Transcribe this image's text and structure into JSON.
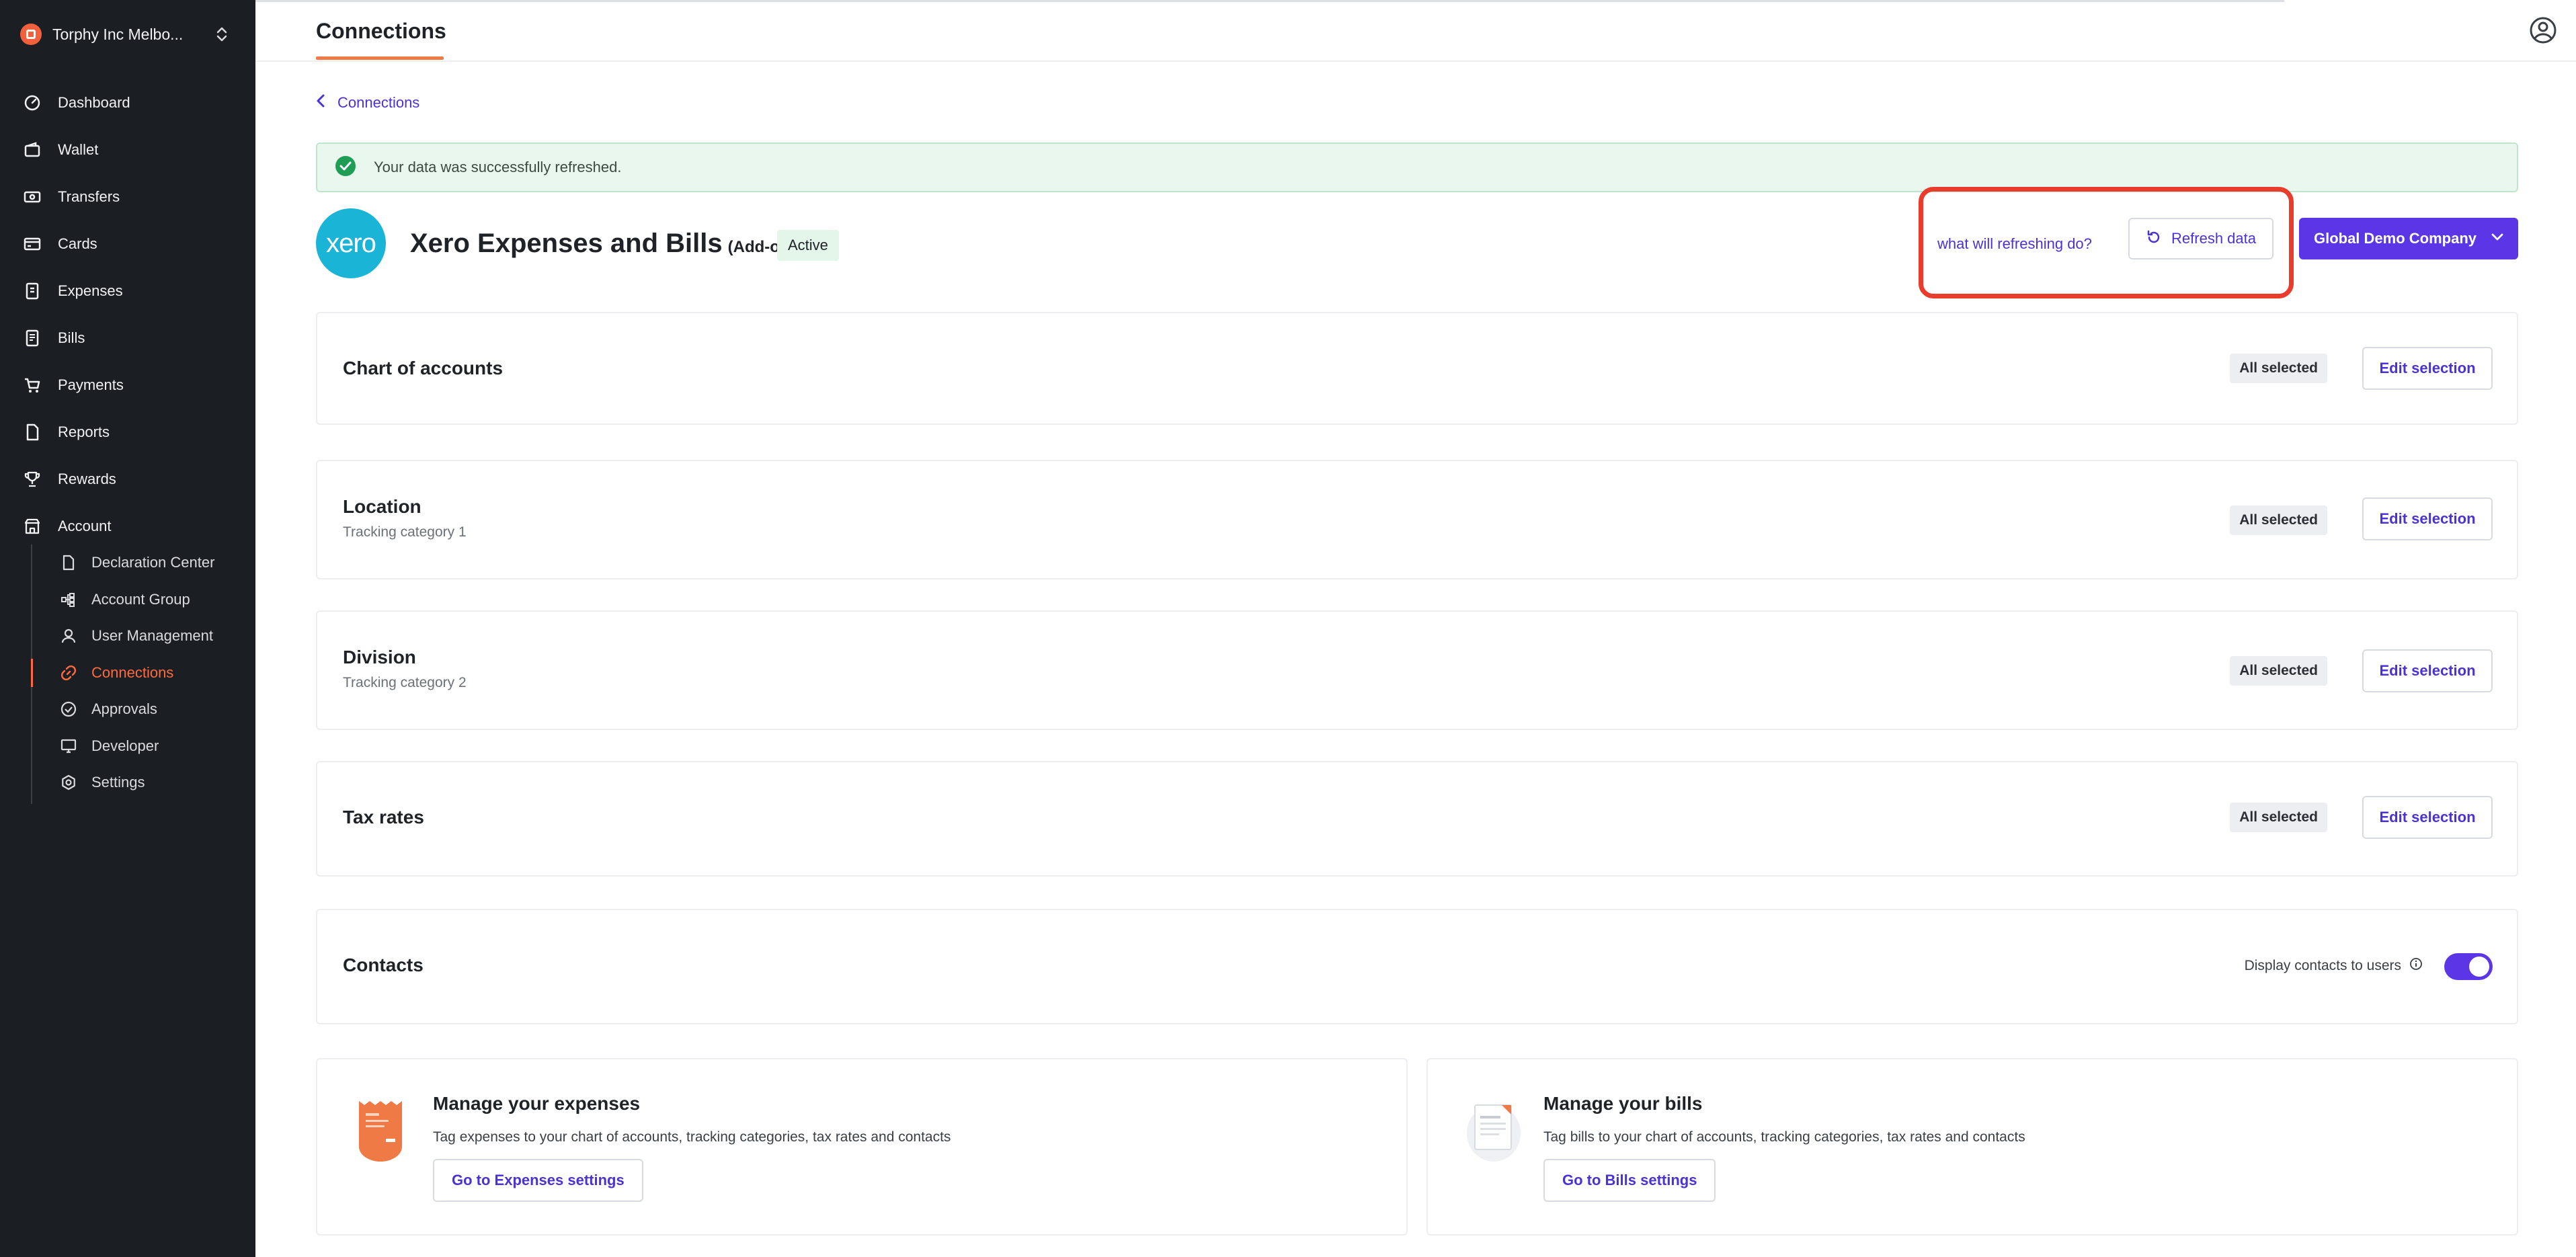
{
  "sidebar": {
    "org_name": "Torphy Inc Melbo...",
    "items": [
      {
        "label": "Dashboard",
        "icon": "dashboard-icon"
      },
      {
        "label": "Wallet",
        "icon": "wallet-icon"
      },
      {
        "label": "Transfers",
        "icon": "transfers-icon"
      },
      {
        "label": "Cards",
        "icon": "card-icon"
      },
      {
        "label": "Expenses",
        "icon": "receipt-icon"
      },
      {
        "label": "Bills",
        "icon": "bill-icon"
      },
      {
        "label": "Payments",
        "icon": "cart-icon"
      },
      {
        "label": "Reports",
        "icon": "report-icon"
      },
      {
        "label": "Rewards",
        "icon": "trophy-icon"
      },
      {
        "label": "Account",
        "icon": "building-icon"
      }
    ],
    "sub_items": [
      {
        "label": "Declaration Center",
        "icon": "document-icon"
      },
      {
        "label": "Account Group",
        "icon": "hierarchy-icon"
      },
      {
        "label": "User Management",
        "icon": "user-icon"
      },
      {
        "label": "Connections",
        "icon": "link-icon",
        "active": true
      },
      {
        "label": "Approvals",
        "icon": "check-circle-icon"
      },
      {
        "label": "Developer",
        "icon": "monitor-icon"
      },
      {
        "label": "Settings",
        "icon": "gear-icon"
      }
    ]
  },
  "header": {
    "title": "Connections"
  },
  "breadcrumb": {
    "back_label": "Connections"
  },
  "alert": {
    "message": "Your data was successfully refreshed."
  },
  "connection": {
    "logo_text": "xero",
    "title": "Xero Expenses and Bills",
    "addon": "(Add-on)",
    "status": "Active",
    "help_link": "what will refreshing do?",
    "refresh_label": "Refresh data",
    "company_label": "Global Demo Company"
  },
  "sections": [
    {
      "title": "Chart of accounts",
      "subtitle": "",
      "status": "All selected",
      "button": "Edit selection"
    },
    {
      "title": "Location",
      "subtitle": "Tracking category 1",
      "status": "All selected",
      "button": "Edit selection"
    },
    {
      "title": "Division",
      "subtitle": "Tracking category 2",
      "status": "All selected",
      "button": "Edit selection"
    },
    {
      "title": "Tax rates",
      "subtitle": "",
      "status": "All selected",
      "button": "Edit selection"
    }
  ],
  "contacts": {
    "title": "Contacts",
    "toggle_label": "Display contacts to users",
    "toggle_on": true
  },
  "promos": [
    {
      "title": "Manage your expenses",
      "description": "Tag expenses to your chart of accounts, tracking categories, tax rates and contacts",
      "button": "Go to Expenses settings"
    },
    {
      "title": "Manage your bills",
      "description": "Tag bills to your chart of accounts, tracking categories, tax rates and contacts",
      "button": "Go to Bills settings"
    }
  ],
  "colors": {
    "sidebar_bg": "#1b1e22",
    "accent": "#5a36e6",
    "active_nav": "#ff6b3d",
    "link": "#4b32d6",
    "success": "#1f9d55",
    "highlight": "#ea3c2c",
    "xero_blue": "#1ab4d7"
  }
}
